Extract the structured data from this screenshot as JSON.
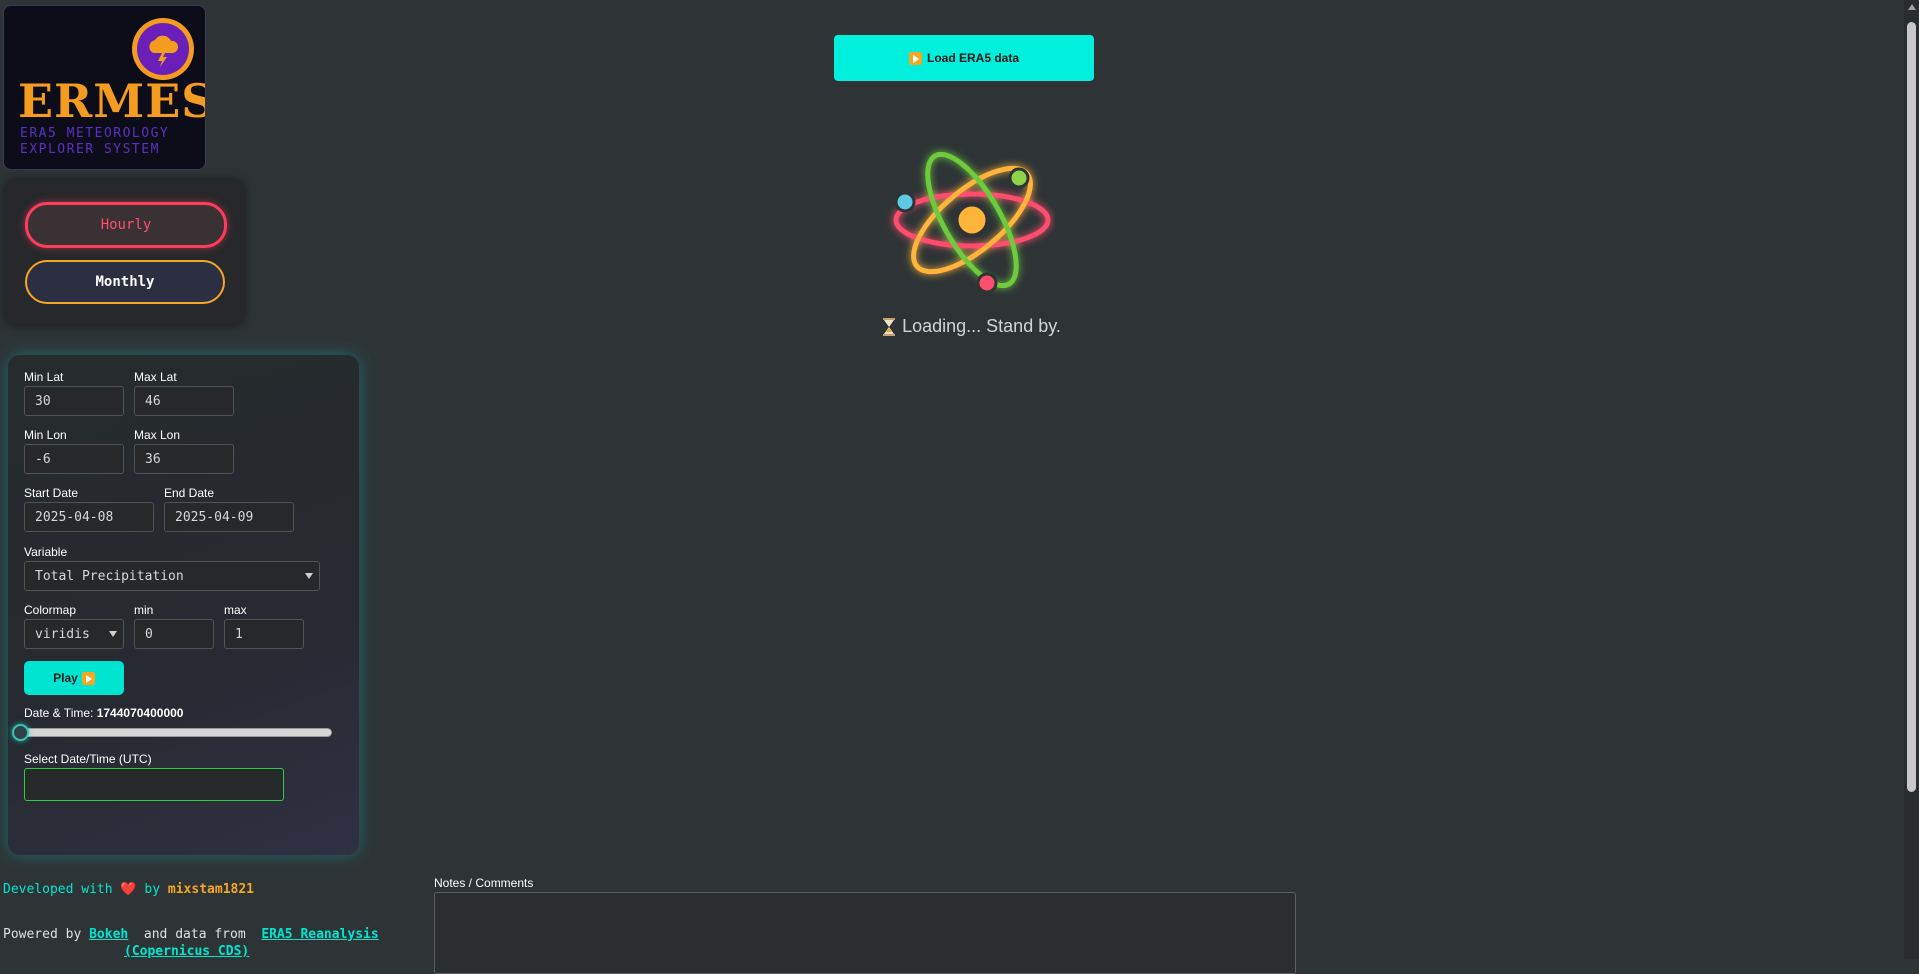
{
  "logo": {
    "title": "ERMES",
    "subtitle_line1": "ERA5 METEOROLOGY",
    "subtitle_line2": "EXPLORER SYSTEM"
  },
  "mode_toggle": {
    "hourly_label": "Hourly",
    "monthly_label": "Monthly",
    "active": "Hourly"
  },
  "load_button": {
    "label": "Load ERA5 data",
    "icon": "play-icon"
  },
  "loading": {
    "text": "Loading... Stand by.",
    "icon": "hourglass-icon"
  },
  "controls": {
    "min_lat": {
      "label": "Min Lat",
      "value": "30"
    },
    "max_lat": {
      "label": "Max Lat",
      "value": "46"
    },
    "min_lon": {
      "label": "Min Lon",
      "value": "-6"
    },
    "max_lon": {
      "label": "Max Lon",
      "value": "36"
    },
    "start_date": {
      "label": "Start Date",
      "value": "2025-04-08"
    },
    "end_date": {
      "label": "End Date",
      "value": "2025-04-09"
    },
    "variable": {
      "label": "Variable",
      "value": "Total Precipitation"
    },
    "colormap": {
      "label": "Colormap",
      "value": "viridis"
    },
    "cmin": {
      "label": "min",
      "value": "0"
    },
    "cmax": {
      "label": "max",
      "value": "1"
    },
    "play_label": "Play",
    "datetime_label": "Date & Time:",
    "datetime_value": "1744070400000",
    "slider_position": 0,
    "select_datetime_label": "Select Date/Time (UTC)",
    "select_datetime_value": ""
  },
  "footer": {
    "dev_prefix": "Developed with",
    "dev_by": "by",
    "author": "mixstam1821",
    "powered_prefix": "Powered by",
    "bokeh": "Bokeh",
    "data_from": "and data from",
    "era5_line1": "ERA5 Reanalysis",
    "era5_line2": "(Copernicus CDS)"
  },
  "notes": {
    "label": "Notes / Comments",
    "value": ""
  },
  "colors": {
    "background": "#2e3436",
    "accent": "#00e5d1",
    "hourly": "#ff3b5c",
    "monthly": "#f5a623"
  }
}
